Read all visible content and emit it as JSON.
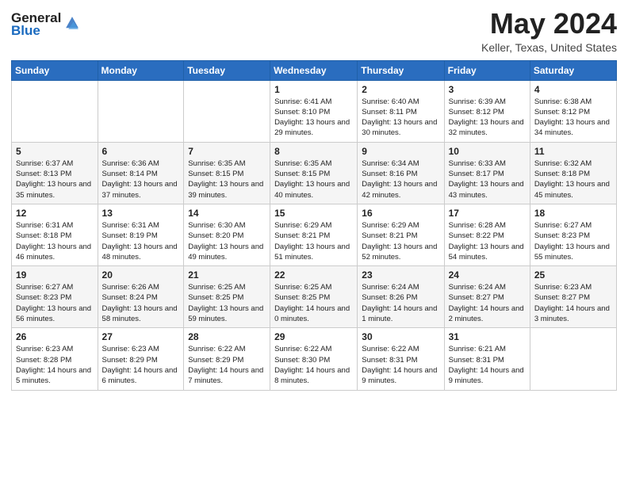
{
  "header": {
    "logo_general": "General",
    "logo_blue": "Blue",
    "title": "May 2024",
    "location": "Keller, Texas, United States"
  },
  "days_of_week": [
    "Sunday",
    "Monday",
    "Tuesday",
    "Wednesday",
    "Thursday",
    "Friday",
    "Saturday"
  ],
  "weeks": [
    [
      {
        "day": "",
        "sunrise": "",
        "sunset": "",
        "daylight": ""
      },
      {
        "day": "",
        "sunrise": "",
        "sunset": "",
        "daylight": ""
      },
      {
        "day": "",
        "sunrise": "",
        "sunset": "",
        "daylight": ""
      },
      {
        "day": "1",
        "sunrise": "Sunrise: 6:41 AM",
        "sunset": "Sunset: 8:10 PM",
        "daylight": "Daylight: 13 hours and 29 minutes."
      },
      {
        "day": "2",
        "sunrise": "Sunrise: 6:40 AM",
        "sunset": "Sunset: 8:11 PM",
        "daylight": "Daylight: 13 hours and 30 minutes."
      },
      {
        "day": "3",
        "sunrise": "Sunrise: 6:39 AM",
        "sunset": "Sunset: 8:12 PM",
        "daylight": "Daylight: 13 hours and 32 minutes."
      },
      {
        "day": "4",
        "sunrise": "Sunrise: 6:38 AM",
        "sunset": "Sunset: 8:12 PM",
        "daylight": "Daylight: 13 hours and 34 minutes."
      }
    ],
    [
      {
        "day": "5",
        "sunrise": "Sunrise: 6:37 AM",
        "sunset": "Sunset: 8:13 PM",
        "daylight": "Daylight: 13 hours and 35 minutes."
      },
      {
        "day": "6",
        "sunrise": "Sunrise: 6:36 AM",
        "sunset": "Sunset: 8:14 PM",
        "daylight": "Daylight: 13 hours and 37 minutes."
      },
      {
        "day": "7",
        "sunrise": "Sunrise: 6:35 AM",
        "sunset": "Sunset: 8:15 PM",
        "daylight": "Daylight: 13 hours and 39 minutes."
      },
      {
        "day": "8",
        "sunrise": "Sunrise: 6:35 AM",
        "sunset": "Sunset: 8:15 PM",
        "daylight": "Daylight: 13 hours and 40 minutes."
      },
      {
        "day": "9",
        "sunrise": "Sunrise: 6:34 AM",
        "sunset": "Sunset: 8:16 PM",
        "daylight": "Daylight: 13 hours and 42 minutes."
      },
      {
        "day": "10",
        "sunrise": "Sunrise: 6:33 AM",
        "sunset": "Sunset: 8:17 PM",
        "daylight": "Daylight: 13 hours and 43 minutes."
      },
      {
        "day": "11",
        "sunrise": "Sunrise: 6:32 AM",
        "sunset": "Sunset: 8:18 PM",
        "daylight": "Daylight: 13 hours and 45 minutes."
      }
    ],
    [
      {
        "day": "12",
        "sunrise": "Sunrise: 6:31 AM",
        "sunset": "Sunset: 8:18 PM",
        "daylight": "Daylight: 13 hours and 46 minutes."
      },
      {
        "day": "13",
        "sunrise": "Sunrise: 6:31 AM",
        "sunset": "Sunset: 8:19 PM",
        "daylight": "Daylight: 13 hours and 48 minutes."
      },
      {
        "day": "14",
        "sunrise": "Sunrise: 6:30 AM",
        "sunset": "Sunset: 8:20 PM",
        "daylight": "Daylight: 13 hours and 49 minutes."
      },
      {
        "day": "15",
        "sunrise": "Sunrise: 6:29 AM",
        "sunset": "Sunset: 8:21 PM",
        "daylight": "Daylight: 13 hours and 51 minutes."
      },
      {
        "day": "16",
        "sunrise": "Sunrise: 6:29 AM",
        "sunset": "Sunset: 8:21 PM",
        "daylight": "Daylight: 13 hours and 52 minutes."
      },
      {
        "day": "17",
        "sunrise": "Sunrise: 6:28 AM",
        "sunset": "Sunset: 8:22 PM",
        "daylight": "Daylight: 13 hours and 54 minutes."
      },
      {
        "day": "18",
        "sunrise": "Sunrise: 6:27 AM",
        "sunset": "Sunset: 8:23 PM",
        "daylight": "Daylight: 13 hours and 55 minutes."
      }
    ],
    [
      {
        "day": "19",
        "sunrise": "Sunrise: 6:27 AM",
        "sunset": "Sunset: 8:23 PM",
        "daylight": "Daylight: 13 hours and 56 minutes."
      },
      {
        "day": "20",
        "sunrise": "Sunrise: 6:26 AM",
        "sunset": "Sunset: 8:24 PM",
        "daylight": "Daylight: 13 hours and 58 minutes."
      },
      {
        "day": "21",
        "sunrise": "Sunrise: 6:25 AM",
        "sunset": "Sunset: 8:25 PM",
        "daylight": "Daylight: 13 hours and 59 minutes."
      },
      {
        "day": "22",
        "sunrise": "Sunrise: 6:25 AM",
        "sunset": "Sunset: 8:25 PM",
        "daylight": "Daylight: 14 hours and 0 minutes."
      },
      {
        "day": "23",
        "sunrise": "Sunrise: 6:24 AM",
        "sunset": "Sunset: 8:26 PM",
        "daylight": "Daylight: 14 hours and 1 minute."
      },
      {
        "day": "24",
        "sunrise": "Sunrise: 6:24 AM",
        "sunset": "Sunset: 8:27 PM",
        "daylight": "Daylight: 14 hours and 2 minutes."
      },
      {
        "day": "25",
        "sunrise": "Sunrise: 6:23 AM",
        "sunset": "Sunset: 8:27 PM",
        "daylight": "Daylight: 14 hours and 3 minutes."
      }
    ],
    [
      {
        "day": "26",
        "sunrise": "Sunrise: 6:23 AM",
        "sunset": "Sunset: 8:28 PM",
        "daylight": "Daylight: 14 hours and 5 minutes."
      },
      {
        "day": "27",
        "sunrise": "Sunrise: 6:23 AM",
        "sunset": "Sunset: 8:29 PM",
        "daylight": "Daylight: 14 hours and 6 minutes."
      },
      {
        "day": "28",
        "sunrise": "Sunrise: 6:22 AM",
        "sunset": "Sunset: 8:29 PM",
        "daylight": "Daylight: 14 hours and 7 minutes."
      },
      {
        "day": "29",
        "sunrise": "Sunrise: 6:22 AM",
        "sunset": "Sunset: 8:30 PM",
        "daylight": "Daylight: 14 hours and 8 minutes."
      },
      {
        "day": "30",
        "sunrise": "Sunrise: 6:22 AM",
        "sunset": "Sunset: 8:31 PM",
        "daylight": "Daylight: 14 hours and 9 minutes."
      },
      {
        "day": "31",
        "sunrise": "Sunrise: 6:21 AM",
        "sunset": "Sunset: 8:31 PM",
        "daylight": "Daylight: 14 hours and 9 minutes."
      },
      {
        "day": "",
        "sunrise": "",
        "sunset": "",
        "daylight": ""
      }
    ]
  ]
}
